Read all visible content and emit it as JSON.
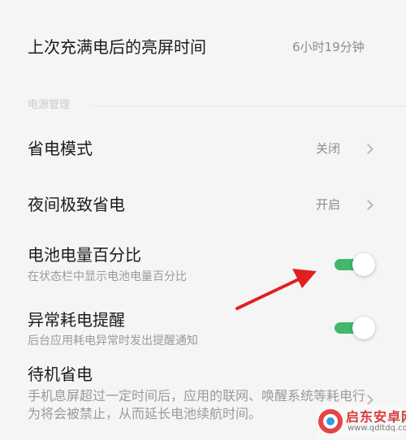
{
  "screen_time": {
    "label": "上次充满电后的亮屏时间",
    "value": "6小时19分钟"
  },
  "power_section": {
    "header": "电源管理"
  },
  "power_saving_mode": {
    "label": "省电模式",
    "value": "关闭"
  },
  "night_saving": {
    "label": "夜间极致省电",
    "value": "开启"
  },
  "battery_percentage": {
    "label": "电池电量百分比",
    "description": "在状态栏中显示电池电量百分比",
    "enabled": true
  },
  "abnormal_alert": {
    "label": "异常耗电提醒",
    "description": "后台应用耗电异常时发出提醒通知",
    "enabled": true
  },
  "standby_saving": {
    "label": "待机省电",
    "description": "手机息屏超过一定时间后，应用的联网、唤醒系统等耗电行为将会被禁止，从而延长电池续航时间。"
  },
  "colors": {
    "toggle_on": "#43b86a",
    "arrow": "#e02020",
    "background": "#f5f5f5"
  },
  "watermark": {
    "name": "启东安卓网",
    "url": "www.qdltdq.com"
  }
}
